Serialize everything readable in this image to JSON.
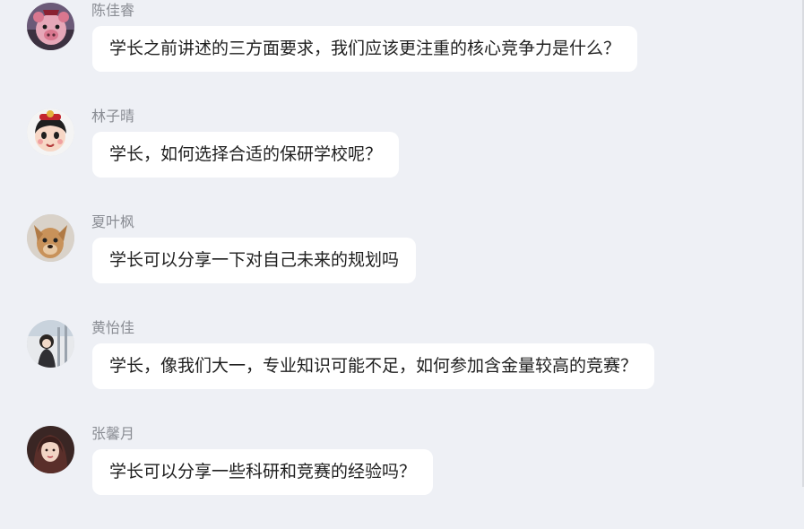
{
  "messages": [
    {
      "sender": "陈佳睿",
      "text": "学长之前讲述的三方面要求，我们应该更注重的核心竞争力是什么？",
      "avatar_icon": "cartoon-pig-avatar-icon"
    },
    {
      "sender": "林子晴",
      "text": "学长，如何选择合适的保研学校呢？",
      "avatar_icon": "cartoon-girl-avatar-icon"
    },
    {
      "sender": "夏叶枫",
      "text": "学长可以分享一下对自己未来的规划吗",
      "avatar_icon": "dog-avatar-icon"
    },
    {
      "sender": "黄怡佳",
      "text": "学长，像我们大一，专业知识可能不足，如何参加含金量较高的竞赛？",
      "avatar_icon": "photo-avatar-icon"
    },
    {
      "sender": "张馨月",
      "text": "学长可以分享一些科研和竞赛的经验吗？",
      "avatar_icon": "portrait-avatar-icon"
    }
  ],
  "colors": {
    "background": "#eef0f5",
    "bubble": "#ffffff",
    "sender_text": "#8a8d94",
    "message_text": "#1f1f1f"
  }
}
